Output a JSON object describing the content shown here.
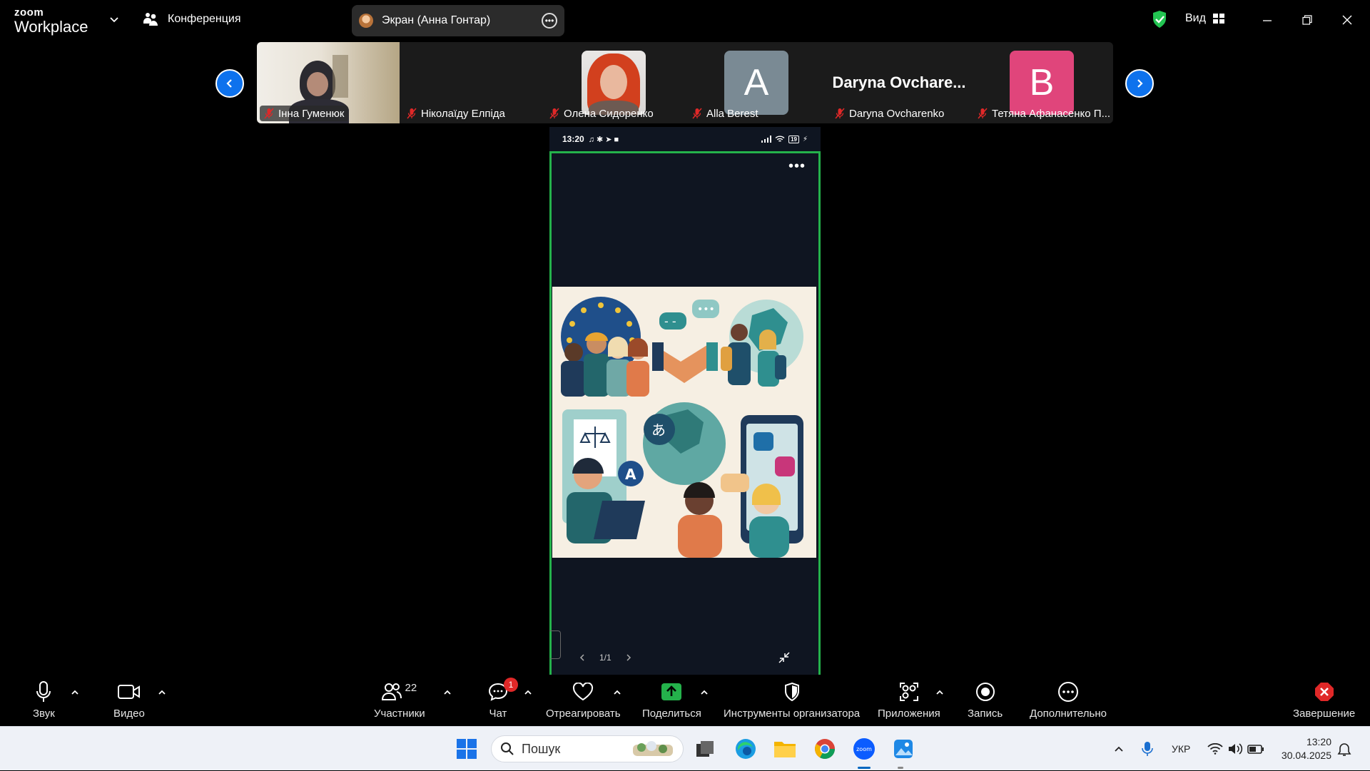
{
  "topbar": {
    "brand_small": "zoom",
    "brand_big": "Workplace",
    "conference_label": "Конференция",
    "share_label": "Экран (Анна Гонтар)",
    "view_label": "Вид"
  },
  "participants": [
    {
      "name": "Інна Гуменюк",
      "type": "video"
    },
    {
      "name": "Ніколаїду Елпіда",
      "type": "dark"
    },
    {
      "name": "Олена Сидоренко",
      "type": "photo"
    },
    {
      "name": "Alla Berest",
      "type": "letter",
      "letter": "A",
      "color": "#7a8a94"
    },
    {
      "name": "Daryna Ovcharenko",
      "type": "name",
      "display": "Daryna  Ovchare..."
    },
    {
      "name": "Тетяна Афанасенко П...",
      "type": "letter",
      "letter": "B",
      "color": "#e0457b"
    }
  ],
  "phone": {
    "time": "13:20",
    "battery": "19",
    "page": "1/1"
  },
  "toolbar": {
    "audio": "Звук",
    "video": "Видео",
    "participants": "Участники",
    "participants_count": "22",
    "chat": "Чат",
    "chat_badge": "1",
    "react": "Отреагировать",
    "share": "Поделиться",
    "host_tools": "Инструменты организатора",
    "apps": "Приложения",
    "record": "Запись",
    "more": "Дополнительно",
    "end": "Завершение"
  },
  "taskbar": {
    "search_placeholder": "Пошук",
    "lang": "УКР",
    "time": "13:20",
    "date": "30.04.2025"
  },
  "colors": {
    "accent_blue": "#0e72ed",
    "share_green": "#24b24b",
    "end_red": "#e02828"
  }
}
